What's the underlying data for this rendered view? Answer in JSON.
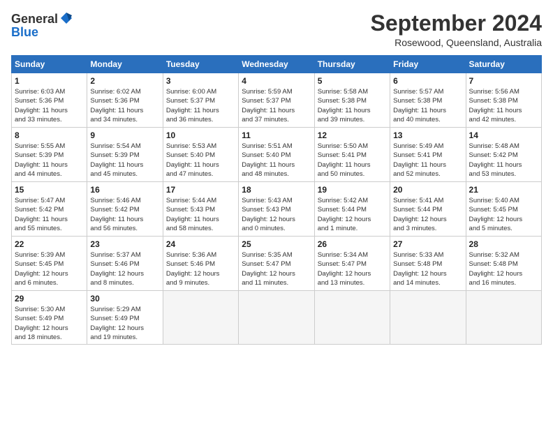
{
  "header": {
    "logo_general": "General",
    "logo_blue": "Blue",
    "month": "September 2024",
    "location": "Rosewood, Queensland, Australia"
  },
  "days_of_week": [
    "Sunday",
    "Monday",
    "Tuesday",
    "Wednesday",
    "Thursday",
    "Friday",
    "Saturday"
  ],
  "weeks": [
    [
      {
        "day": "1",
        "sunrise": "6:03 AM",
        "sunset": "5:36 PM",
        "daylight": "11 hours and 33 minutes."
      },
      {
        "day": "2",
        "sunrise": "6:02 AM",
        "sunset": "5:36 PM",
        "daylight": "11 hours and 34 minutes."
      },
      {
        "day": "3",
        "sunrise": "6:00 AM",
        "sunset": "5:37 PM",
        "daylight": "11 hours and 36 minutes."
      },
      {
        "day": "4",
        "sunrise": "5:59 AM",
        "sunset": "5:37 PM",
        "daylight": "11 hours and 37 minutes."
      },
      {
        "day": "5",
        "sunrise": "5:58 AM",
        "sunset": "5:38 PM",
        "daylight": "11 hours and 39 minutes."
      },
      {
        "day": "6",
        "sunrise": "5:57 AM",
        "sunset": "5:38 PM",
        "daylight": "11 hours and 40 minutes."
      },
      {
        "day": "7",
        "sunrise": "5:56 AM",
        "sunset": "5:38 PM",
        "daylight": "11 hours and 42 minutes."
      }
    ],
    [
      {
        "day": "8",
        "sunrise": "5:55 AM",
        "sunset": "5:39 PM",
        "daylight": "11 hours and 44 minutes."
      },
      {
        "day": "9",
        "sunrise": "5:54 AM",
        "sunset": "5:39 PM",
        "daylight": "11 hours and 45 minutes."
      },
      {
        "day": "10",
        "sunrise": "5:53 AM",
        "sunset": "5:40 PM",
        "daylight": "11 hours and 47 minutes."
      },
      {
        "day": "11",
        "sunrise": "5:51 AM",
        "sunset": "5:40 PM",
        "daylight": "11 hours and 48 minutes."
      },
      {
        "day": "12",
        "sunrise": "5:50 AM",
        "sunset": "5:41 PM",
        "daylight": "11 hours and 50 minutes."
      },
      {
        "day": "13",
        "sunrise": "5:49 AM",
        "sunset": "5:41 PM",
        "daylight": "11 hours and 52 minutes."
      },
      {
        "day": "14",
        "sunrise": "5:48 AM",
        "sunset": "5:42 PM",
        "daylight": "11 hours and 53 minutes."
      }
    ],
    [
      {
        "day": "15",
        "sunrise": "5:47 AM",
        "sunset": "5:42 PM",
        "daylight": "11 hours and 55 minutes."
      },
      {
        "day": "16",
        "sunrise": "5:46 AM",
        "sunset": "5:42 PM",
        "daylight": "11 hours and 56 minutes."
      },
      {
        "day": "17",
        "sunrise": "5:44 AM",
        "sunset": "5:43 PM",
        "daylight": "11 hours and 58 minutes."
      },
      {
        "day": "18",
        "sunrise": "5:43 AM",
        "sunset": "5:43 PM",
        "daylight": "12 hours and 0 minutes."
      },
      {
        "day": "19",
        "sunrise": "5:42 AM",
        "sunset": "5:44 PM",
        "daylight": "12 hours and 1 minute."
      },
      {
        "day": "20",
        "sunrise": "5:41 AM",
        "sunset": "5:44 PM",
        "daylight": "12 hours and 3 minutes."
      },
      {
        "day": "21",
        "sunrise": "5:40 AM",
        "sunset": "5:45 PM",
        "daylight": "12 hours and 5 minutes."
      }
    ],
    [
      {
        "day": "22",
        "sunrise": "5:39 AM",
        "sunset": "5:45 PM",
        "daylight": "12 hours and 6 minutes."
      },
      {
        "day": "23",
        "sunrise": "5:37 AM",
        "sunset": "5:46 PM",
        "daylight": "12 hours and 8 minutes."
      },
      {
        "day": "24",
        "sunrise": "5:36 AM",
        "sunset": "5:46 PM",
        "daylight": "12 hours and 9 minutes."
      },
      {
        "day": "25",
        "sunrise": "5:35 AM",
        "sunset": "5:47 PM",
        "daylight": "12 hours and 11 minutes."
      },
      {
        "day": "26",
        "sunrise": "5:34 AM",
        "sunset": "5:47 PM",
        "daylight": "12 hours and 13 minutes."
      },
      {
        "day": "27",
        "sunrise": "5:33 AM",
        "sunset": "5:48 PM",
        "daylight": "12 hours and 14 minutes."
      },
      {
        "day": "28",
        "sunrise": "5:32 AM",
        "sunset": "5:48 PM",
        "daylight": "12 hours and 16 minutes."
      }
    ],
    [
      {
        "day": "29",
        "sunrise": "5:30 AM",
        "sunset": "5:49 PM",
        "daylight": "12 hours and 18 minutes."
      },
      {
        "day": "30",
        "sunrise": "5:29 AM",
        "sunset": "5:49 PM",
        "daylight": "12 hours and 19 minutes."
      },
      null,
      null,
      null,
      null,
      null
    ]
  ]
}
